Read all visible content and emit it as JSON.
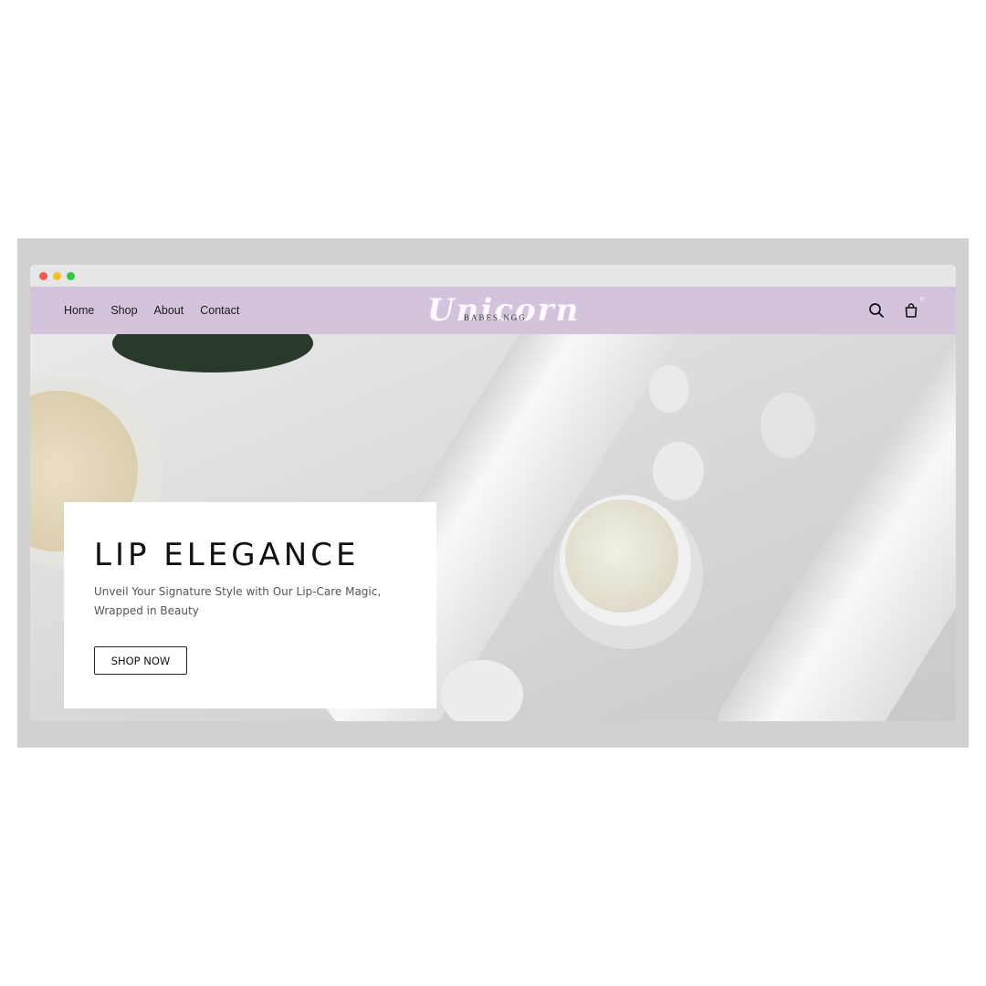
{
  "nav": {
    "links": [
      "Home",
      "Shop",
      "About",
      "Contact"
    ],
    "logo_script": "Unicorn",
    "logo_sub": "BABES.NGG",
    "cart_count": "0",
    "icons": {
      "search": "search-icon",
      "cart": "shopping-bag-icon"
    },
    "background": "#d3c3dc"
  },
  "hero": {
    "title": "LIP ELEGANCE",
    "subtitle": "Unveil Your Signature Style with Our Lip-Care Magic, Wrapped in Beauty",
    "cta_label": "SHOP NOW"
  },
  "window_controls": {
    "colors": [
      "#ee5a52",
      "#f5bd2f",
      "#2fc840"
    ]
  }
}
